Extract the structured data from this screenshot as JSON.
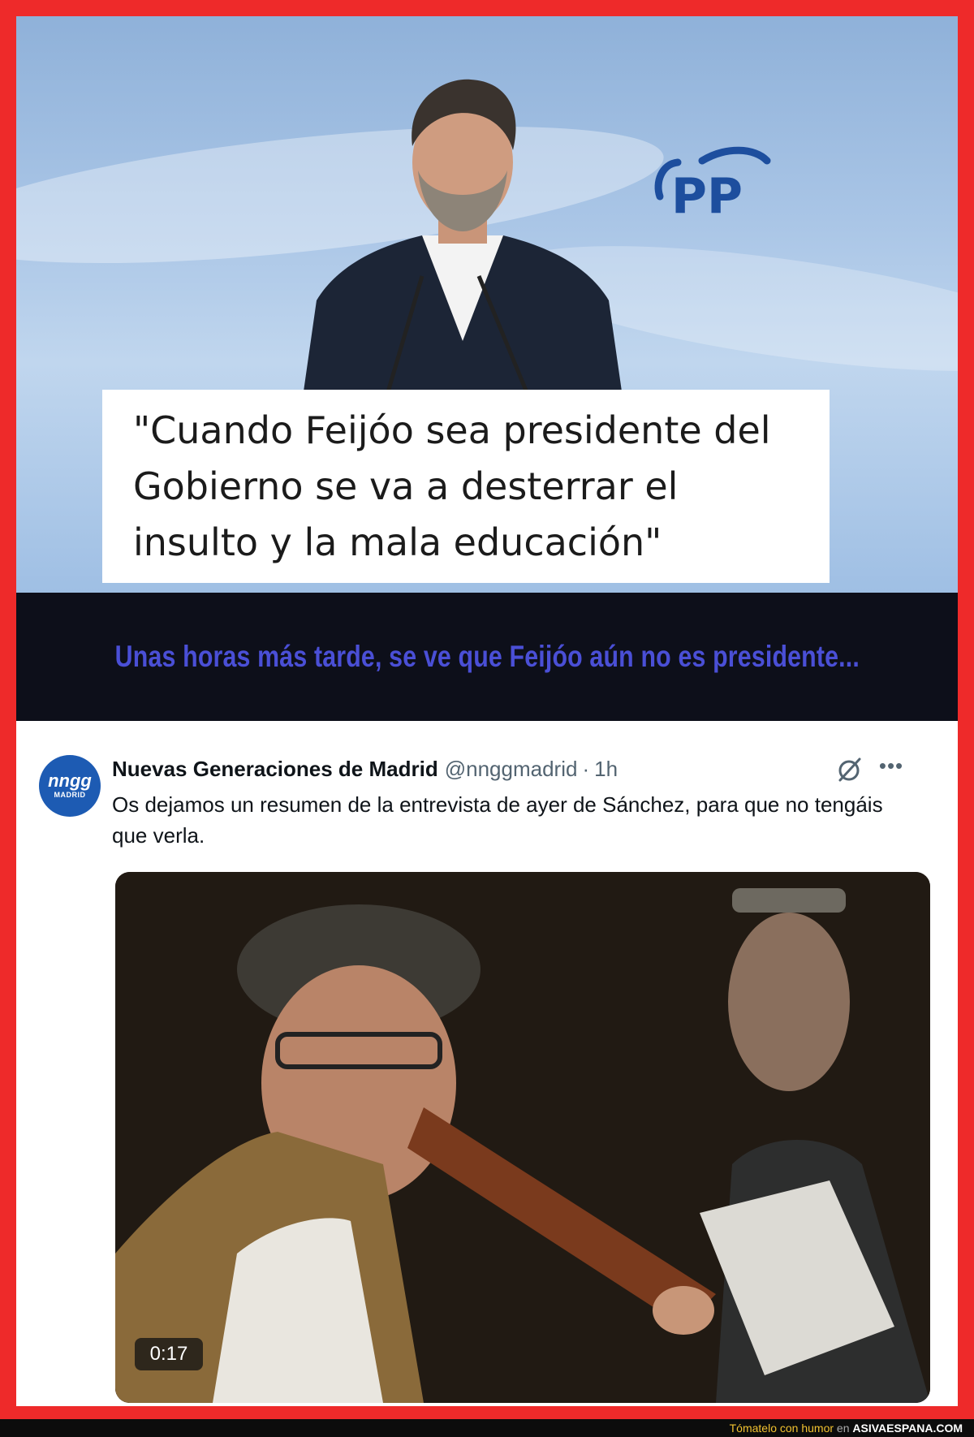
{
  "top_panel": {
    "logo_text": "PP",
    "quote": "\"Cuando Feijóo sea presidente del Gobierno se va a desterrar el insulto y la mala educación\""
  },
  "caption": {
    "text": "Unas horas más tarde, se ve que Feijóo aún no es presidente..."
  },
  "tweet": {
    "avatar_line1": "nngg",
    "avatar_line2": "MADRID",
    "author_name": "Nuevas Generaciones de Madrid",
    "handle": "@nnggmadrid",
    "separator": "·",
    "time": "1h",
    "body": "Os dejamos un resumen de la entrevista de ayer de Sánchez, para que no tengáis que verla.",
    "video_duration": "0:17",
    "icons": [
      "grok-icon",
      "more-icon"
    ]
  },
  "footer": {
    "prefix": "Tómatelo con humor",
    "connector": " en ",
    "site": "ASIVAESPANA.COM"
  },
  "colors": {
    "frame": "#ee2a2a",
    "caption_text": "#4a4fd6",
    "caption_bg": "#0d0f1a",
    "pp_blue": "#1d4e9e"
  }
}
